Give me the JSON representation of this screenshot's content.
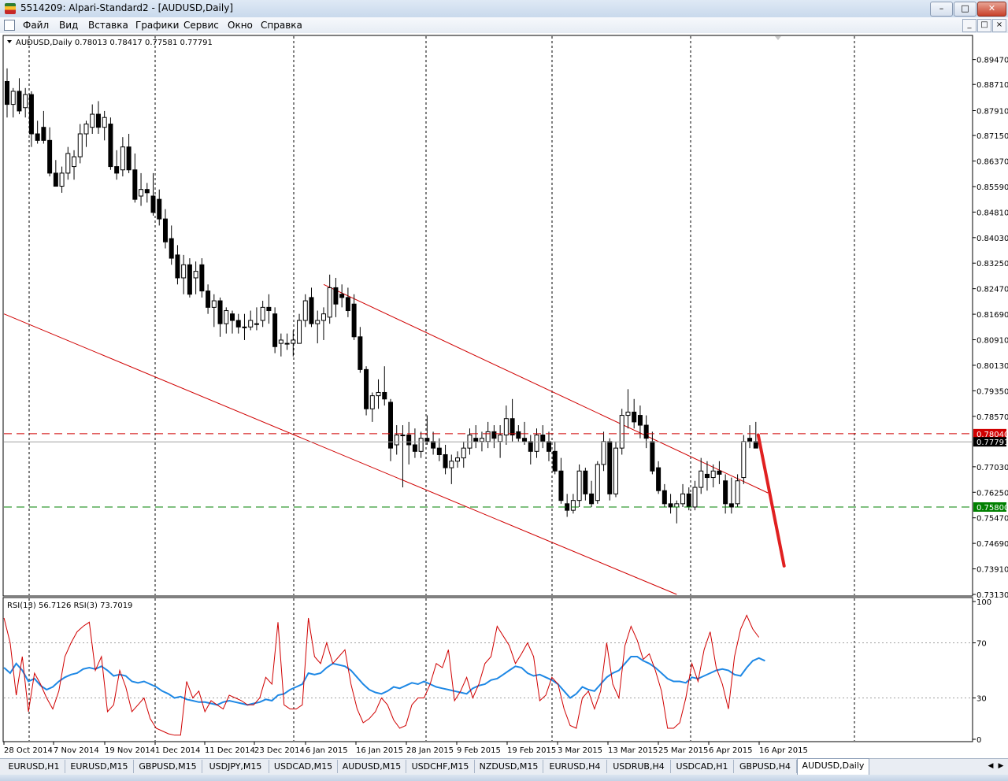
{
  "window": {
    "title": "5514209: Alpari-Standard2 - [AUDUSD,Daily]",
    "controls": [
      "–",
      "□",
      "✕"
    ]
  },
  "menu": {
    "items": [
      "Файл",
      "Вид",
      "Вставка",
      "Графики",
      "Сервис",
      "Окно",
      "Справка"
    ],
    "mdi_controls": [
      "_",
      "□",
      "×"
    ]
  },
  "chart": {
    "header": "AUDUSD,Daily  0.78013 0.78417 0.77581 0.77791",
    "price_ticks": [
      "0.89470",
      "0.88710",
      "0.87910",
      "0.87150",
      "0.86370",
      "0.85590",
      "0.84810",
      "0.84030",
      "0.83250",
      "0.82470",
      "0.81690",
      "0.80910",
      "0.80130",
      "0.79350",
      "0.78570",
      "0.77030",
      "0.76250",
      "0.75470",
      "0.74690",
      "0.73910",
      "0.73130"
    ],
    "date_labels": [
      "28 Oct 2014",
      "7 Nov 2014",
      "19 Nov 2014",
      "1 Dec 2014",
      "11 Dec 2014",
      "23 Dec 2014",
      "6 Jan 2015",
      "16 Jan 2015",
      "28 Jan 2015",
      "9 Feb 2015",
      "19 Feb 2015",
      "3 Mar 2015",
      "13 Mar 2015",
      "25 Mar 2015",
      "6 Apr 2015",
      "16 Apr 2015"
    ],
    "resistance_label": "0.78040",
    "current_label": "0.77791",
    "support_label": "0.75800",
    "rsi_header": "RSI(13) 56.7126  RSI(3) 73.7019",
    "rsi_ticks": [
      "100",
      "70",
      "30",
      "0"
    ],
    "colors": {
      "bull": "#ffffff",
      "bear": "#000000",
      "channel": "#d00000",
      "resistance": "#d00000",
      "support": "#008000",
      "rsi13": "#1e88e5",
      "rsi3": "#d00000",
      "arrow": "#e02020"
    }
  },
  "chart_data": {
    "type": "candlestick",
    "symbol": "AUDUSD",
    "timeframe": "Daily",
    "ylim": [
      0.7313,
      0.8987
    ],
    "candles": [
      [
        0.888,
        0.892,
        0.877,
        0.881
      ],
      [
        0.881,
        0.886,
        0.877,
        0.885
      ],
      [
        0.885,
        0.889,
        0.878,
        0.879
      ],
      [
        0.88,
        0.886,
        0.877,
        0.884
      ],
      [
        0.884,
        0.885,
        0.868,
        0.872
      ],
      [
        0.872,
        0.876,
        0.869,
        0.87
      ],
      [
        0.874,
        0.879,
        0.869,
        0.87
      ],
      [
        0.87,
        0.874,
        0.859,
        0.86
      ],
      [
        0.86,
        0.864,
        0.856,
        0.856
      ],
      [
        0.856,
        0.862,
        0.854,
        0.86
      ],
      [
        0.86,
        0.868,
        0.858,
        0.866
      ],
      [
        0.862,
        0.867,
        0.858,
        0.865
      ],
      [
        0.865,
        0.875,
        0.863,
        0.872
      ],
      [
        0.872,
        0.876,
        0.868,
        0.875
      ],
      [
        0.874,
        0.881,
        0.872,
        0.878
      ],
      [
        0.878,
        0.882,
        0.872,
        0.874
      ],
      [
        0.874,
        0.879,
        0.87,
        0.877
      ],
      [
        0.875,
        0.877,
        0.861,
        0.862
      ],
      [
        0.862,
        0.867,
        0.858,
        0.86
      ],
      [
        0.861,
        0.871,
        0.859,
        0.868
      ],
      [
        0.868,
        0.872,
        0.86,
        0.861
      ],
      [
        0.861,
        0.866,
        0.851,
        0.852
      ],
      [
        0.853,
        0.86,
        0.85,
        0.855
      ],
      [
        0.855,
        0.857,
        0.851,
        0.854
      ],
      [
        0.853,
        0.86,
        0.847,
        0.848
      ],
      [
        0.852,
        0.855,
        0.844,
        0.846
      ],
      [
        0.846,
        0.849,
        0.837,
        0.839
      ],
      [
        0.84,
        0.844,
        0.832,
        0.834
      ],
      [
        0.835,
        0.838,
        0.826,
        0.828
      ],
      [
        0.828,
        0.835,
        0.823,
        0.832
      ],
      [
        0.832,
        0.834,
        0.822,
        0.823
      ],
      [
        0.828,
        0.833,
        0.823,
        0.83
      ],
      [
        0.832,
        0.834,
        0.822,
        0.824
      ],
      [
        0.824,
        0.826,
        0.817,
        0.819
      ],
      [
        0.819,
        0.823,
        0.813,
        0.821
      ],
      [
        0.821,
        0.822,
        0.81,
        0.814
      ],
      [
        0.814,
        0.819,
        0.811,
        0.818
      ],
      [
        0.817,
        0.818,
        0.811,
        0.815
      ],
      [
        0.815,
        0.817,
        0.811,
        0.813
      ],
      [
        0.813,
        0.817,
        0.809,
        0.813
      ],
      [
        0.813,
        0.818,
        0.812,
        0.815
      ],
      [
        0.814,
        0.819,
        0.812,
        0.814
      ],
      [
        0.815,
        0.821,
        0.813,
        0.819
      ],
      [
        0.819,
        0.823,
        0.814,
        0.818
      ],
      [
        0.817,
        0.819,
        0.805,
        0.807
      ],
      [
        0.808,
        0.811,
        0.804,
        0.809
      ],
      [
        0.808,
        0.811,
        0.806,
        0.808
      ],
      [
        0.808,
        0.812,
        0.804,
        0.809
      ],
      [
        0.808,
        0.817,
        0.808,
        0.815
      ],
      [
        0.815,
        0.823,
        0.813,
        0.821
      ],
      [
        0.822,
        0.825,
        0.813,
        0.814
      ],
      [
        0.814,
        0.818,
        0.808,
        0.815
      ],
      [
        0.815,
        0.819,
        0.809,
        0.817
      ],
      [
        0.816,
        0.829,
        0.814,
        0.825
      ],
      [
        0.825,
        0.828,
        0.816,
        0.82
      ],
      [
        0.823,
        0.826,
        0.819,
        0.822
      ],
      [
        0.822,
        0.825,
        0.816,
        0.818
      ],
      [
        0.82,
        0.823,
        0.809,
        0.81
      ],
      [
        0.81,
        0.813,
        0.799,
        0.8
      ],
      [
        0.8,
        0.801,
        0.786,
        0.788
      ],
      [
        0.788,
        0.793,
        0.784,
        0.792
      ],
      [
        0.792,
        0.797,
        0.788,
        0.793
      ],
      [
        0.793,
        0.801,
        0.789,
        0.791
      ],
      [
        0.79,
        0.791,
        0.772,
        0.776
      ],
      [
        0.777,
        0.783,
        0.774,
        0.78
      ],
      [
        0.78,
        0.783,
        0.764,
        0.78
      ],
      [
        0.78,
        0.784,
        0.771,
        0.777
      ],
      [
        0.777,
        0.782,
        0.773,
        0.775
      ],
      [
        0.775,
        0.781,
        0.773,
        0.779
      ],
      [
        0.779,
        0.786,
        0.777,
        0.778
      ],
      [
        0.778,
        0.781,
        0.774,
        0.776
      ],
      [
        0.776,
        0.779,
        0.772,
        0.774
      ],
      [
        0.774,
        0.777,
        0.768,
        0.77
      ],
      [
        0.77,
        0.774,
        0.765,
        0.772
      ],
      [
        0.772,
        0.775,
        0.77,
        0.773
      ],
      [
        0.773,
        0.778,
        0.77,
        0.776
      ],
      [
        0.776,
        0.782,
        0.774,
        0.78
      ],
      [
        0.779,
        0.783,
        0.776,
        0.778
      ],
      [
        0.778,
        0.781,
        0.775,
        0.779
      ],
      [
        0.778,
        0.784,
        0.776,
        0.781
      ],
      [
        0.781,
        0.783,
        0.776,
        0.779
      ],
      [
        0.778,
        0.783,
        0.773,
        0.78
      ],
      [
        0.78,
        0.789,
        0.777,
        0.785
      ],
      [
        0.785,
        0.791,
        0.778,
        0.78
      ],
      [
        0.781,
        0.783,
        0.778,
        0.779
      ],
      [
        0.779,
        0.784,
        0.777,
        0.778
      ],
      [
        0.778,
        0.78,
        0.771,
        0.775
      ],
      [
        0.775,
        0.782,
        0.773,
        0.78
      ],
      [
        0.78,
        0.783,
        0.776,
        0.778
      ],
      [
        0.778,
        0.781,
        0.772,
        0.775
      ],
      [
        0.775,
        0.778,
        0.768,
        0.769
      ],
      [
        0.769,
        0.773,
        0.759,
        0.76
      ],
      [
        0.759,
        0.762,
        0.755,
        0.757
      ],
      [
        0.757,
        0.762,
        0.756,
        0.76
      ],
      [
        0.76,
        0.771,
        0.758,
        0.769
      ],
      [
        0.769,
        0.77,
        0.76,
        0.762
      ],
      [
        0.762,
        0.766,
        0.758,
        0.759
      ],
      [
        0.76,
        0.772,
        0.759,
        0.771
      ],
      [
        0.771,
        0.781,
        0.769,
        0.778
      ],
      [
        0.778,
        0.779,
        0.76,
        0.762
      ],
      [
        0.762,
        0.778,
        0.761,
        0.776
      ],
      [
        0.776,
        0.788,
        0.774,
        0.786
      ],
      [
        0.786,
        0.794,
        0.782,
        0.787
      ],
      [
        0.787,
        0.791,
        0.782,
        0.784
      ],
      [
        0.786,
        0.789,
        0.779,
        0.783
      ],
      [
        0.783,
        0.786,
        0.776,
        0.779
      ],
      [
        0.778,
        0.781,
        0.768,
        0.769
      ],
      [
        0.77,
        0.772,
        0.762,
        0.763
      ],
      [
        0.763,
        0.765,
        0.758,
        0.759
      ],
      [
        0.759,
        0.762,
        0.756,
        0.758
      ],
      [
        0.758,
        0.76,
        0.753,
        0.759
      ],
      [
        0.759,
        0.765,
        0.758,
        0.762
      ],
      [
        0.762,
        0.764,
        0.757,
        0.758
      ],
      [
        0.758,
        0.766,
        0.757,
        0.764
      ],
      [
        0.764,
        0.773,
        0.762,
        0.769
      ],
      [
        0.768,
        0.772,
        0.763,
        0.767
      ],
      [
        0.767,
        0.771,
        0.764,
        0.769
      ],
      [
        0.769,
        0.772,
        0.765,
        0.768
      ],
      [
        0.766,
        0.768,
        0.756,
        0.759
      ],
      [
        0.759,
        0.767,
        0.756,
        0.758
      ],
      [
        0.759,
        0.768,
        0.758,
        0.766
      ],
      [
        0.767,
        0.78,
        0.765,
        0.778
      ],
      [
        0.779,
        0.783,
        0.776,
        0.778
      ],
      [
        0.778,
        0.784,
        0.776,
        0.776
      ]
    ],
    "resistance": 0.7804,
    "support": 0.758,
    "last_price": 0.77791,
    "channel": {
      "upper": [
        [
          52,
          0.826
        ],
        [
          125,
          0.7623
        ]
      ],
      "lower": [
        [
          0,
          0.817
        ],
        [
          110,
          0.7313
        ]
      ]
    },
    "forecast_arrow": [
      [
        123,
        0.78
      ],
      [
        127,
        0.74
      ]
    ],
    "rsi": {
      "ylim": [
        0,
        100
      ],
      "levels": [
        70,
        30
      ],
      "series": [
        {
          "name": "RSI(13)",
          "values": [
            52,
            48,
            55,
            50,
            42,
            44,
            39,
            36,
            38,
            42,
            45,
            47,
            48,
            51,
            52,
            51,
            53,
            50,
            46,
            47,
            46,
            42,
            41,
            42,
            40,
            38,
            35,
            33,
            30,
            31,
            29,
            28,
            27,
            27,
            26,
            25,
            27,
            28,
            27,
            26,
            25,
            26,
            27,
            29,
            28,
            32,
            33,
            36,
            38,
            40,
            48,
            47,
            48,
            52,
            55,
            54,
            53,
            50,
            45,
            40,
            36,
            34,
            33,
            35,
            38,
            37,
            39,
            41,
            40,
            42,
            40,
            38,
            37,
            36,
            35,
            34,
            33,
            37,
            39,
            40,
            43,
            44,
            47,
            50,
            53,
            52,
            48,
            46,
            47,
            45,
            43,
            40,
            35,
            30,
            33,
            38,
            36,
            35,
            40,
            45,
            48,
            50,
            55,
            60,
            60,
            57,
            55,
            52,
            48,
            44,
            42,
            42,
            41,
            45,
            44,
            46,
            48,
            50,
            51,
            50,
            47,
            46,
            52,
            57,
            59,
            57
          ]
        },
        {
          "name": "RSI(3)",
          "values": [
            88,
            70,
            32,
            60,
            20,
            48,
            40,
            30,
            22,
            35,
            60,
            70,
            78,
            82,
            85,
            50,
            60,
            20,
            25,
            50,
            38,
            20,
            25,
            30,
            15,
            8,
            6,
            4,
            3,
            3,
            42,
            30,
            35,
            20,
            28,
            25,
            22,
            32,
            30,
            28,
            25,
            25,
            30,
            45,
            40,
            85,
            25,
            22,
            22,
            25,
            88,
            60,
            55,
            70,
            55,
            60,
            65,
            40,
            22,
            12,
            15,
            20,
            30,
            25,
            14,
            8,
            10,
            25,
            30,
            30,
            40,
            55,
            52,
            65,
            28,
            35,
            45,
            30,
            40,
            55,
            60,
            82,
            75,
            68,
            55,
            62,
            70,
            60,
            28,
            32,
            45,
            40,
            22,
            10,
            8,
            30,
            35,
            22,
            35,
            70,
            40,
            30,
            68,
            82,
            72,
            58,
            62,
            50,
            35,
            8,
            8,
            12,
            30,
            55,
            42,
            65,
            78,
            52,
            40,
            22,
            60,
            80,
            90,
            80,
            74
          ]
        }
      ]
    },
    "date_labels": [
      "28 Oct 2014",
      "7 Nov 2014",
      "19 Nov 2014",
      "1 Dec 2014",
      "11 Dec 2014",
      "23 Dec 2014",
      "6 Jan 2015",
      "16 Jan 2015",
      "28 Jan 2015",
      "9 Feb 2015",
      "19 Feb 2015",
      "3 Mar 2015",
      "13 Mar 2015",
      "25 Mar 2015",
      "6 Apr 2015",
      "16 Apr 2015"
    ]
  },
  "tabs": {
    "items": [
      "EURUSD,H1",
      "EURUSD,M15",
      "GBPUSD,M15",
      "USDJPY,M15",
      "USDCAD,M15",
      "AUDUSD,M15",
      "USDCHF,M15",
      "NZDUSD,M15",
      "EURUSD,H4",
      "USDRUB,H4",
      "USDCAD,H1",
      "GBPUSD,H4",
      "AUDUSD,Daily"
    ],
    "active": "AUDUSD,Daily",
    "scroll": [
      "◀",
      "▶"
    ]
  }
}
